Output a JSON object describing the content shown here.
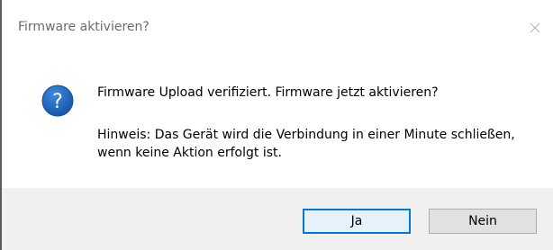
{
  "window": {
    "title": "Firmware aktivieren?",
    "close_icon": "close-icon"
  },
  "message": {
    "icon": "question-icon",
    "icon_color": "#1f65b8",
    "main": "Firmware Upload verifiziert. Firmware jetzt aktivieren?",
    "hint": "Hinweis: Das Gerät wird die Verbindung in einer Minute schließen, wenn keine Aktion erfolgt ist."
  },
  "buttons": {
    "yes_label": "Ja",
    "no_label": "Nein",
    "default_button": "yes",
    "accent_color": "#0078d7"
  }
}
